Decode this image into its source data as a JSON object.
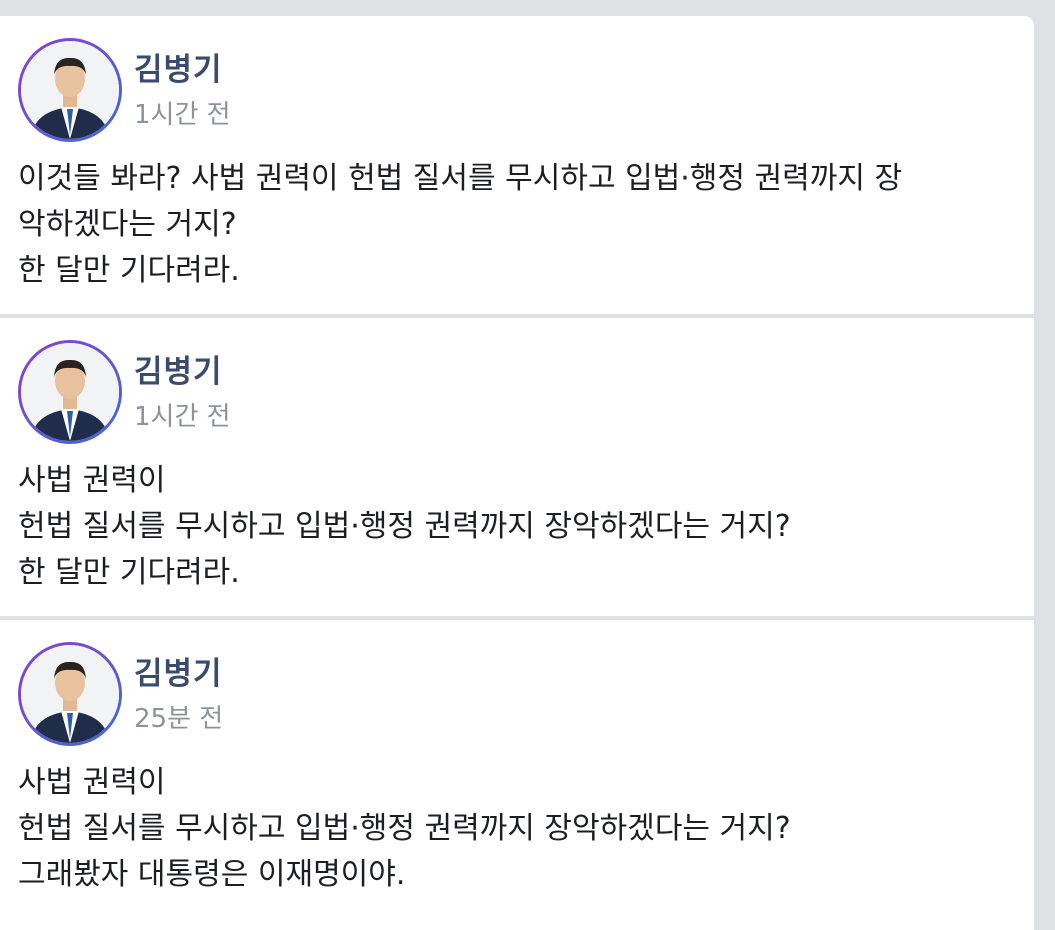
{
  "posts": [
    {
      "author": "김병기",
      "time": "1시간 전",
      "lines": [
        "이것들 봐라? 사법 권력이 헌법 질서를 무시하고 입법·행정 권력까지 장",
        "악하겠다는 거지?",
        "한 달만 기다려라."
      ]
    },
    {
      "author": "김병기",
      "time": "1시간 전",
      "lines": [
        "사법 권력이",
        "헌법 질서를 무시하고 입법·행정 권력까지 장악하겠다는 거지?",
        "한 달만 기다려라."
      ]
    },
    {
      "author": "김병기",
      "time": "25분 전",
      "lines": [
        "사법 권력이",
        "헌법 질서를 무시하고 입법·행정 권력까지 장악하겠다는 거지?",
        "그래봤자 대통령은 이재명이야."
      ]
    }
  ],
  "colors": {
    "background": "#dfe1e5",
    "card": "#ffffff",
    "author": "#3a4b6e",
    "time": "#8e939b",
    "text": "#1c1e21"
  }
}
